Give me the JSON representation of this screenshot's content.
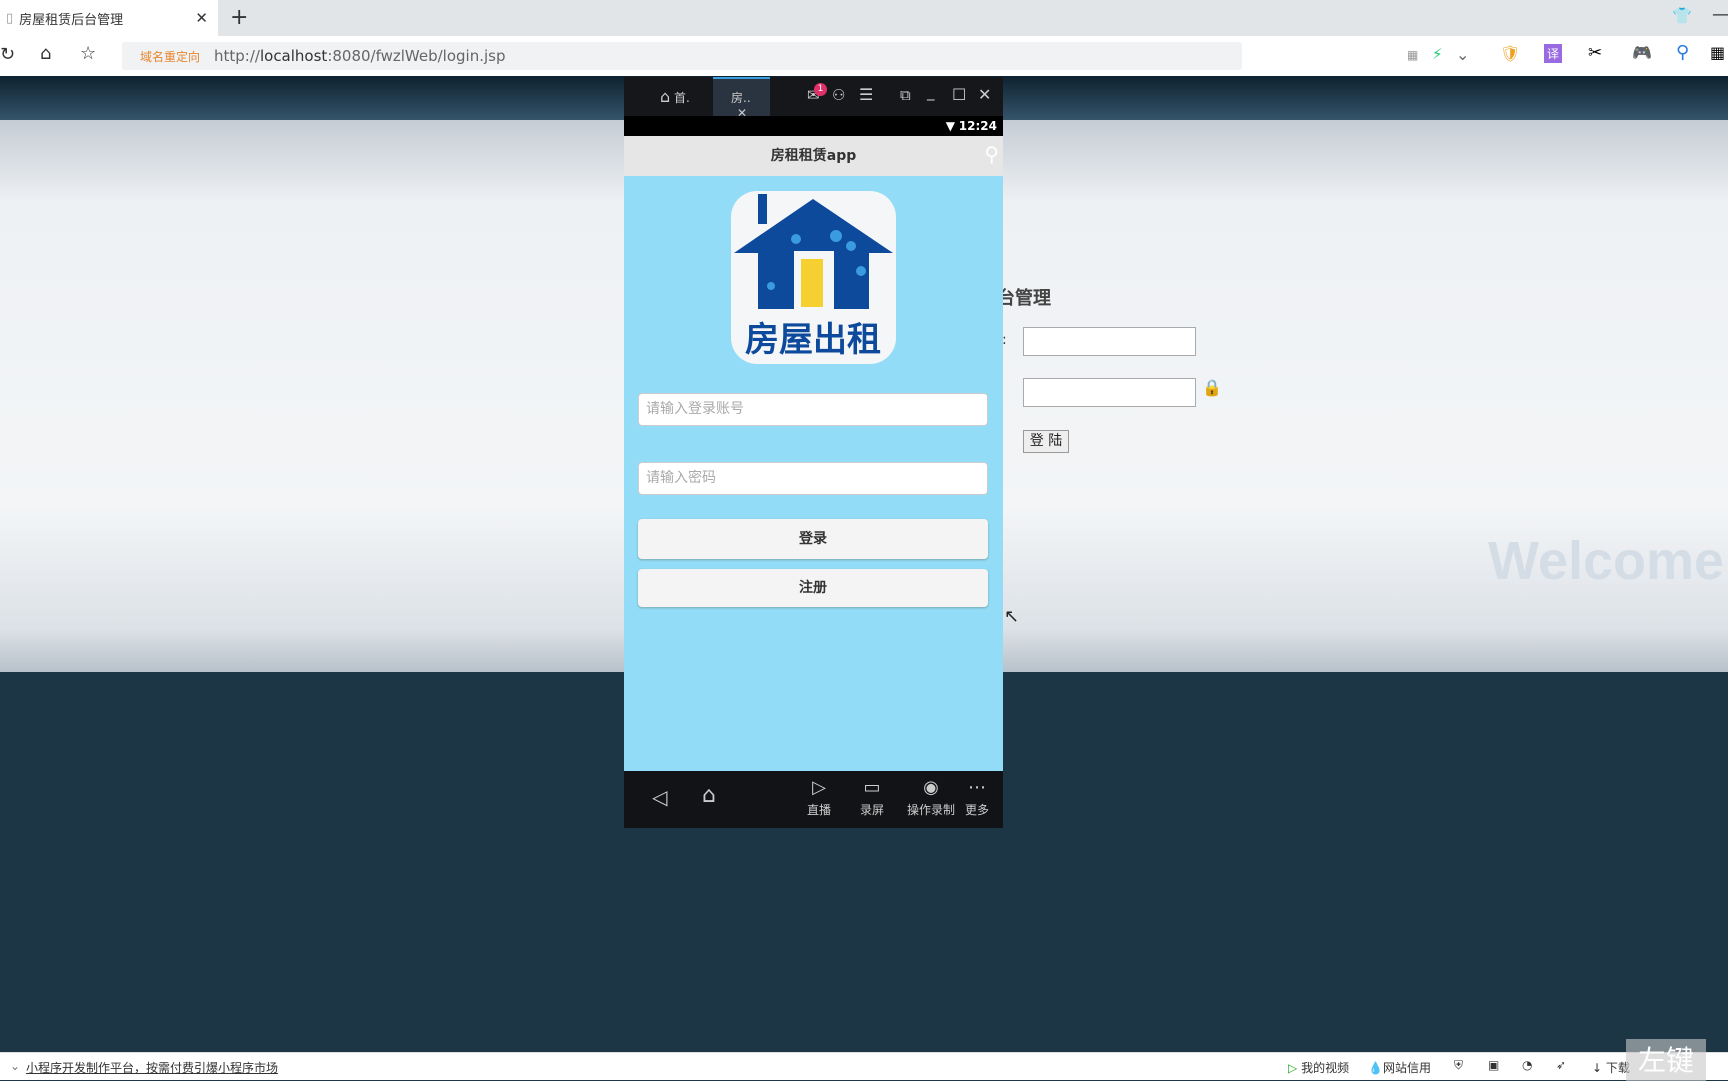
{
  "browser": {
    "tab_title": "房屋租赁后台管理",
    "redirect_label": "域名重定向",
    "url_prefix": "http://",
    "url_host": "localhost",
    "url_rest": ":8080/fwzlWeb/login.jsp"
  },
  "web_page": {
    "title_fragment": "台管理",
    "username_label_fragment": ":",
    "login_button": "登 陆",
    "welcome": "Welcome"
  },
  "emulator": {
    "tabs": [
      {
        "label": "首."
      },
      {
        "label": "房.."
      }
    ],
    "mail_badge": "1",
    "time": "12:24",
    "app": {
      "title": "房租租赁app",
      "logo_text": "房屋出租",
      "account_placeholder": "请输入登录账号",
      "password_placeholder": "请输入密码",
      "login_button": "登录",
      "register_button": "注册"
    },
    "bottom_nav": [
      {
        "label": "直播",
        "icon": "tv-icon"
      },
      {
        "label": "录屏",
        "icon": "video-camera-icon"
      },
      {
        "label": "操作录制",
        "icon": "record-icon"
      },
      {
        "label": "更多",
        "icon": "more-icon"
      }
    ]
  },
  "statusbar": {
    "left_link": "小程序开发制作平台，按需付费引爆小程序市场",
    "items": [
      "我的视频",
      "网站信用",
      "下载"
    ],
    "watermark": "左键"
  },
  "colors": {
    "app_bg": "#92dcf8",
    "logo_blue": "#0d4a9c",
    "page_dark": "#1c3646"
  }
}
